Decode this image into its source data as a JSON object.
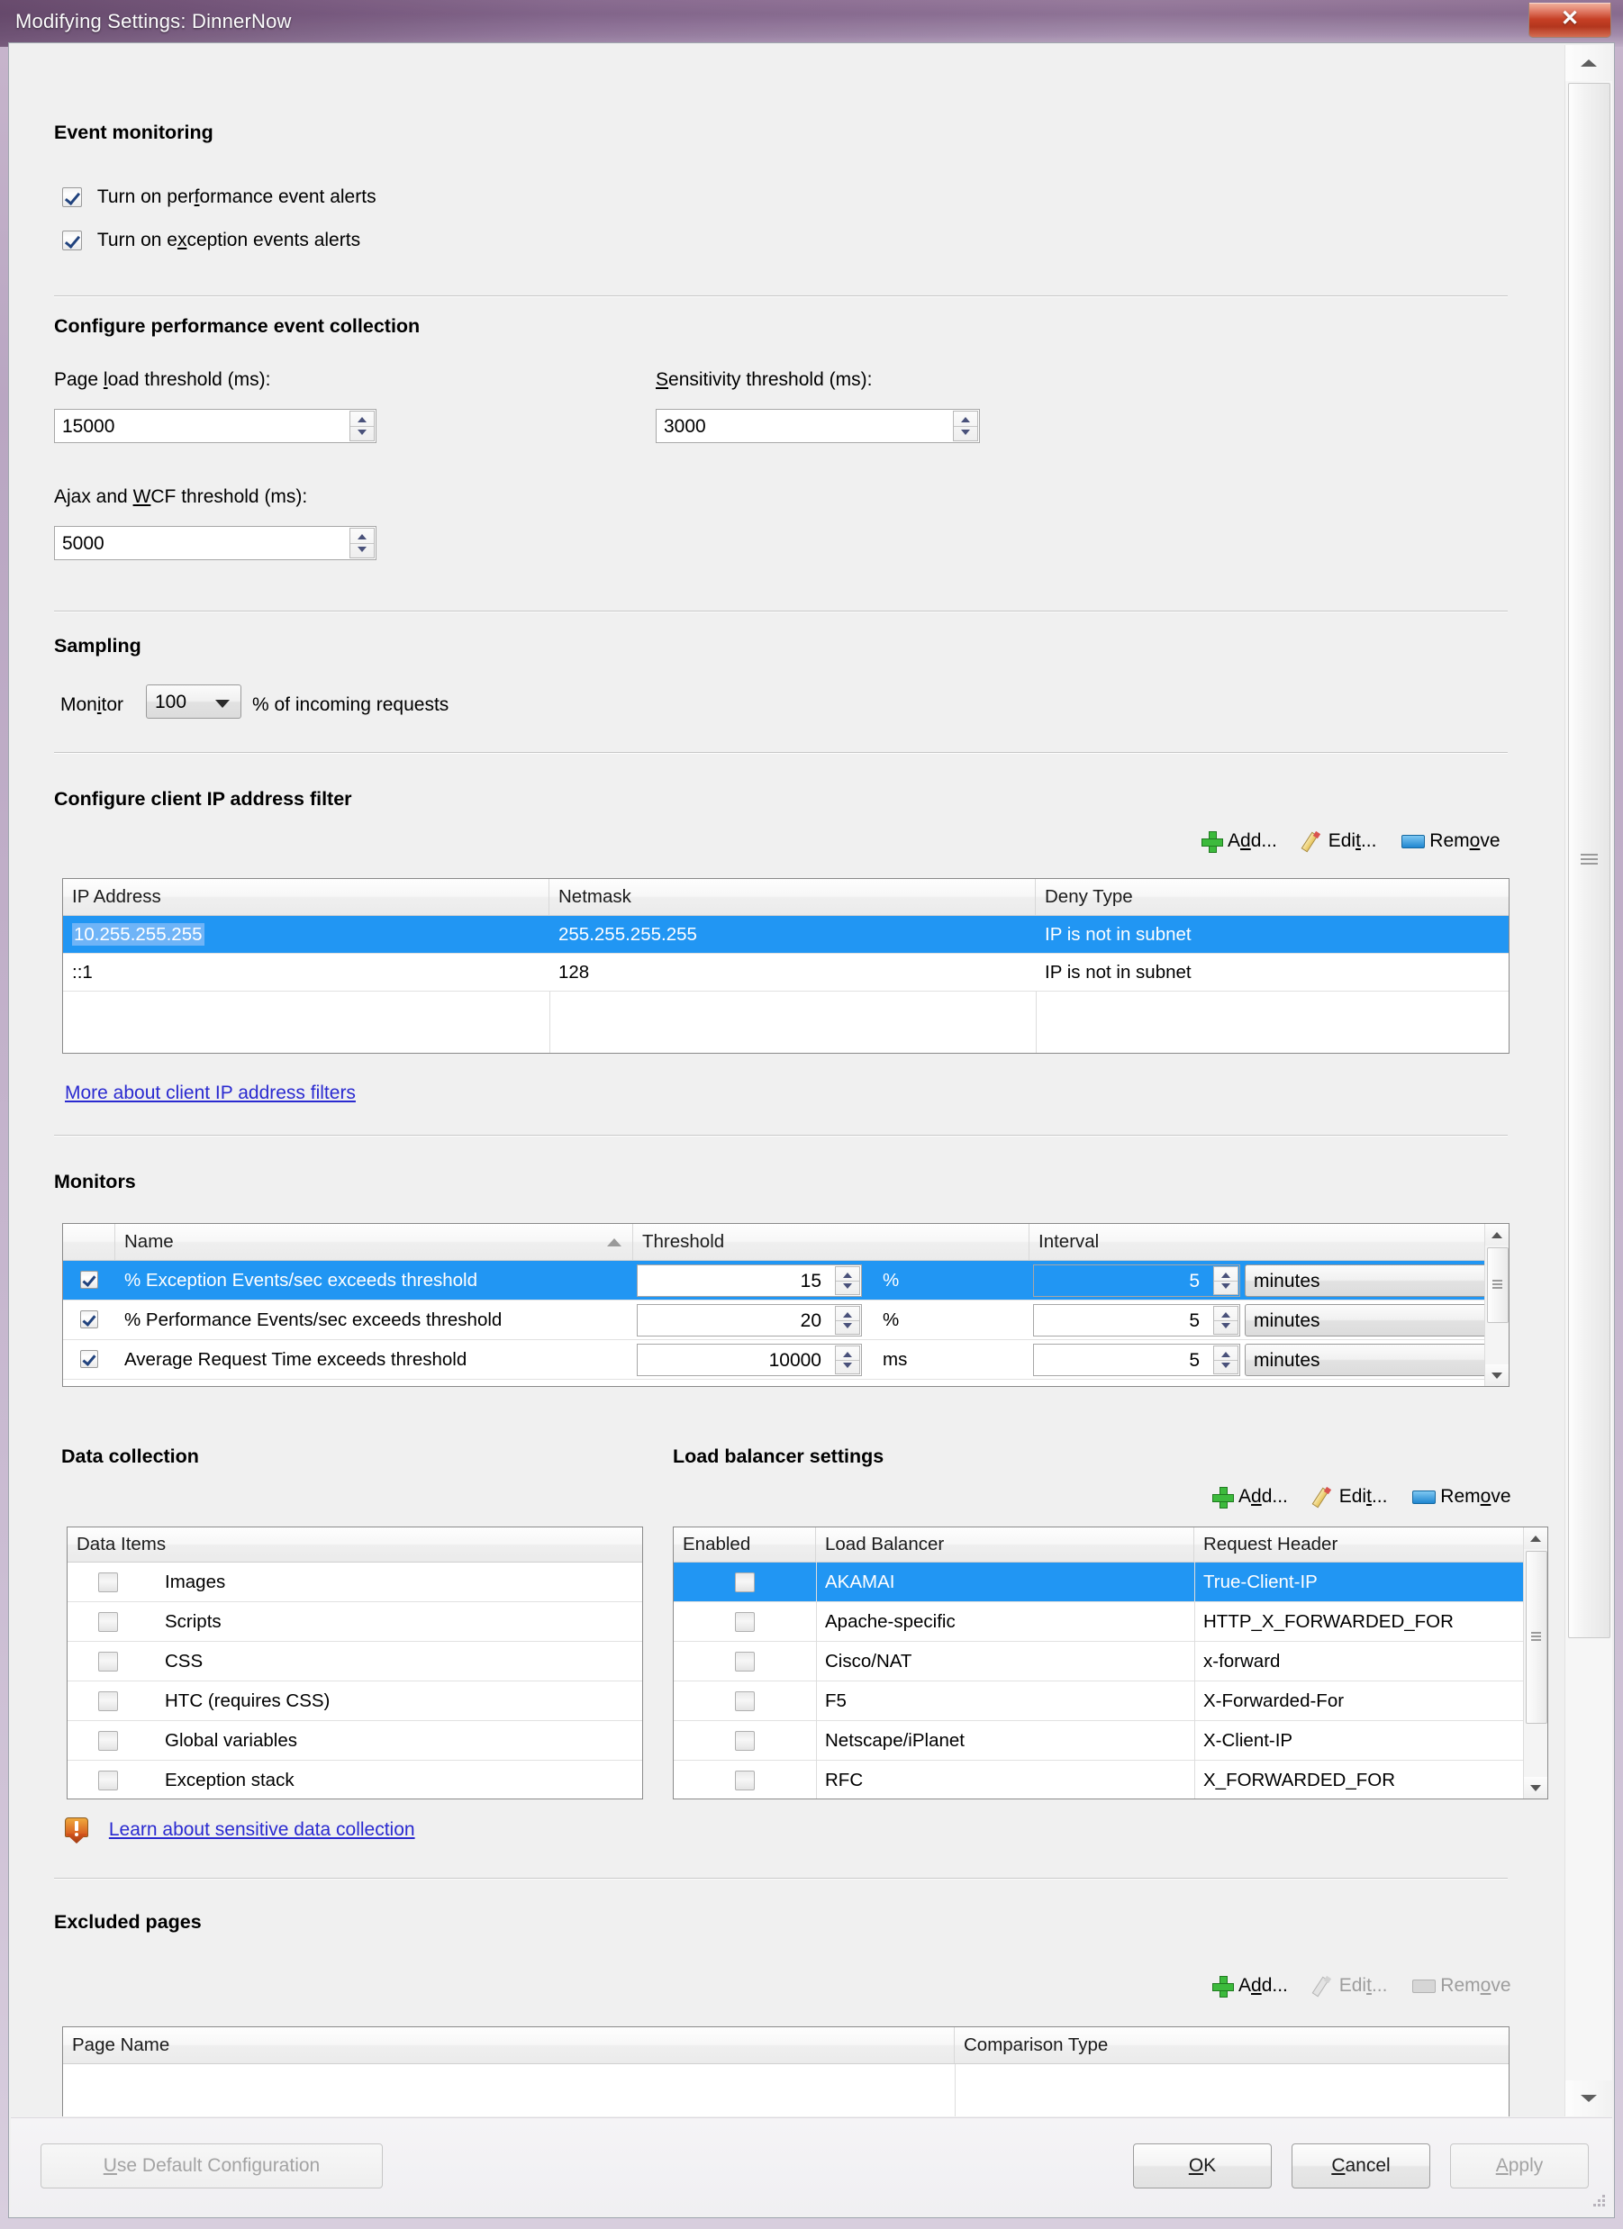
{
  "window": {
    "title": "Modifying Settings: DinnerNow",
    "close_label": "✕",
    "accent_selection": "#2196f3",
    "titlebar_color": "#8a6b8e",
    "close_color": "#c73c20"
  },
  "event_monitoring": {
    "heading": "Event monitoring",
    "checkboxes": [
      {
        "label_pre": "Turn on per",
        "label_accel": "f",
        "label_post": "ormance event alerts",
        "checked": true
      },
      {
        "label_pre": "Turn on e",
        "label_accel": "x",
        "label_post": "ception events alerts",
        "checked": true
      }
    ]
  },
  "performance_collection": {
    "heading": "Configure performance event collection",
    "fields": [
      {
        "label_pre": "Page ",
        "label_accel": "l",
        "label_post": "oad threshold (ms):",
        "value": "15000"
      },
      {
        "label_pre": "",
        "label_accel": "S",
        "label_post": "ensitivity threshold (ms):",
        "value": "3000"
      },
      {
        "label_pre": "Ajax and ",
        "label_accel": "W",
        "label_post": "CF threshold (ms):",
        "value": "5000"
      }
    ]
  },
  "sampling": {
    "heading": "Sampling",
    "label_pre": "Mon",
    "label_accel": "i",
    "label_post": "tor",
    "value": "100",
    "suffix": "% of incoming requests"
  },
  "ip_filter": {
    "heading": "Configure client IP address filter",
    "toolbar": [
      {
        "name": "add",
        "icon": "plus-icon",
        "pre": "A",
        "accel": "d",
        "post": "d...",
        "enabled": true
      },
      {
        "name": "edit",
        "icon": "pencil-icon",
        "pre": "Edi",
        "accel": "t",
        "post": "...",
        "enabled": true
      },
      {
        "name": "remove",
        "icon": "minus-icon",
        "pre": "Rem",
        "accel": "o",
        "post": "ve",
        "enabled": true
      }
    ],
    "columns": [
      "IP Address",
      "Netmask",
      "Deny Type"
    ],
    "rows": [
      {
        "ip": "10.255.255.255",
        "netmask": "255.255.255.255",
        "deny": "IP is not in subnet",
        "selected": true
      },
      {
        "ip": "::1",
        "netmask": "128",
        "deny": "IP is not in subnet",
        "selected": false
      }
    ],
    "link": "More about client IP address filters"
  },
  "monitors": {
    "heading": "Monitors",
    "columns": [
      "Name",
      "Threshold",
      "Interval"
    ],
    "sorted_by": "Name",
    "rows": [
      {
        "enabled": true,
        "name": "% Exception Events/sec exceeds threshold",
        "threshold": "15",
        "unit": "%",
        "interval": "5",
        "interval_unit": "minutes",
        "selected": true
      },
      {
        "enabled": true,
        "name": "% Performance Events/sec exceeds threshold",
        "threshold": "20",
        "unit": "%",
        "interval": "5",
        "interval_unit": "minutes",
        "selected": false
      },
      {
        "enabled": true,
        "name": "Average Request Time exceeds threshold",
        "threshold": "10000",
        "unit": "ms",
        "interval": "5",
        "interval_unit": "minutes",
        "selected": false
      }
    ]
  },
  "data_collection": {
    "heading": "Data collection",
    "column": "Data Items",
    "items": [
      {
        "label": "Images",
        "checked": false
      },
      {
        "label": "Scripts",
        "checked": false
      },
      {
        "label": "CSS",
        "checked": false
      },
      {
        "label": "HTC (requires CSS)",
        "checked": false
      },
      {
        "label": "Global variables",
        "checked": false
      },
      {
        "label": "Exception stack",
        "checked": false
      }
    ],
    "link": "Learn about sensitive data collection",
    "link_icon": "shield-warning-icon"
  },
  "load_balancer": {
    "heading": "Load balancer settings",
    "toolbar": [
      {
        "name": "add",
        "icon": "plus-icon",
        "pre": "A",
        "accel": "d",
        "post": "d...",
        "enabled": true
      },
      {
        "name": "edit",
        "icon": "pencil-icon",
        "pre": "Edi",
        "accel": "t",
        "post": "...",
        "enabled": true
      },
      {
        "name": "remove",
        "icon": "minus-icon",
        "pre": "Rem",
        "accel": "o",
        "post": "ve",
        "enabled": true
      }
    ],
    "columns": [
      "Enabled",
      "Load Balancer",
      "Request Header"
    ],
    "rows": [
      {
        "enabled": false,
        "name": "AKAMAI",
        "header": "True-Client-IP",
        "selected": true
      },
      {
        "enabled": false,
        "name": "Apache-specific",
        "header": "HTTP_X_FORWARDED_FOR",
        "selected": false
      },
      {
        "enabled": false,
        "name": "Cisco/NAT",
        "header": "x-forward",
        "selected": false
      },
      {
        "enabled": false,
        "name": "F5",
        "header": "X-Forwarded-For",
        "selected": false
      },
      {
        "enabled": false,
        "name": "Netscape/iPlanet",
        "header": "X-Client-IP",
        "selected": false
      },
      {
        "enabled": false,
        "name": "RFC",
        "header": "X_FORWARDED_FOR",
        "selected": false
      }
    ]
  },
  "excluded_pages": {
    "heading": "Excluded pages",
    "toolbar": [
      {
        "name": "add",
        "icon": "plus-icon",
        "pre": "A",
        "accel": "d",
        "post": "d...",
        "enabled": true
      },
      {
        "name": "edit",
        "icon": "pencil-icon",
        "pre": "Edi",
        "accel": "t",
        "post": "...",
        "enabled": false
      },
      {
        "name": "remove",
        "icon": "minus-icon",
        "pre": "Rem",
        "accel": "o",
        "post": "ve",
        "enabled": false
      }
    ],
    "columns": [
      "Page Name",
      "Comparison Type"
    ],
    "rows": []
  },
  "footer": {
    "use_default_pre": "",
    "use_default_accel": "U",
    "use_default_post": "se Default Configuration",
    "ok_pre": "",
    "ok_accel": "O",
    "ok_post": "K",
    "cancel_pre": "",
    "cancel_accel": "C",
    "cancel_post": "ancel",
    "apply_pre": "",
    "apply_accel": "A",
    "apply_post": "pply",
    "use_default_enabled": false,
    "ok_enabled": true,
    "cancel_enabled": true,
    "apply_enabled": false
  }
}
